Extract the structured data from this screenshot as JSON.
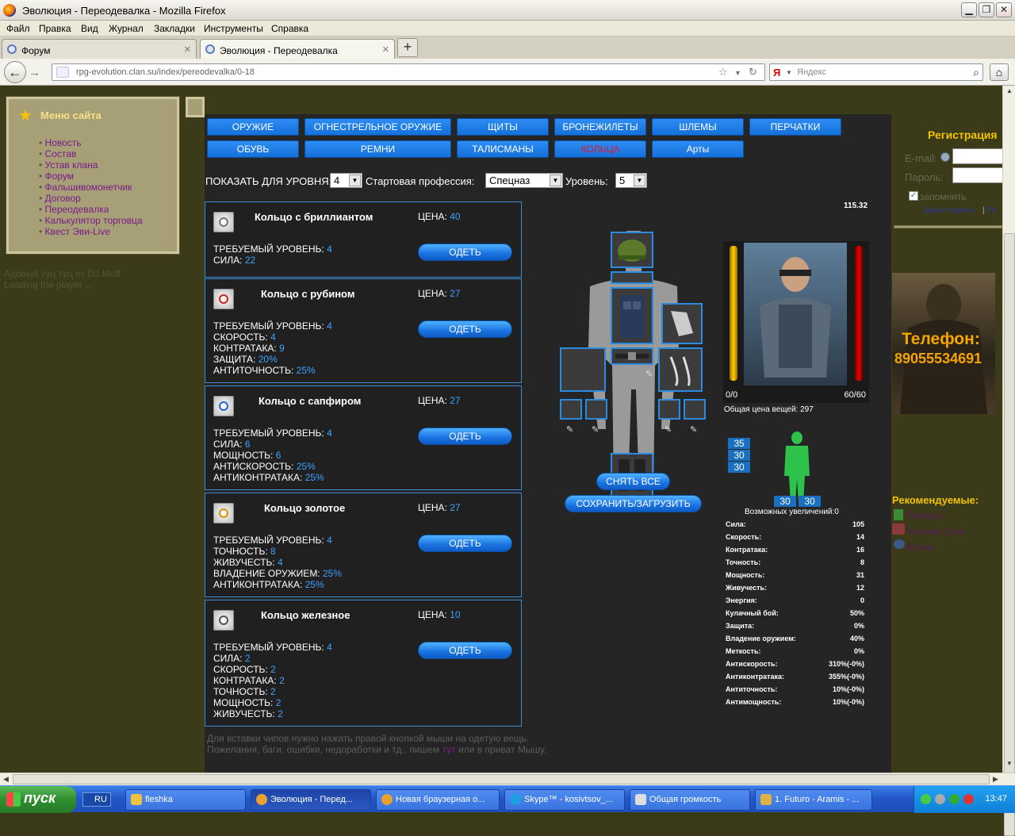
{
  "window": {
    "title": "Эволюция - Переодевалка - Mozilla Firefox"
  },
  "menu": [
    "Файл",
    "Правка",
    "Вид",
    "Журнал",
    "Закладки",
    "Инструменты",
    "Справка"
  ],
  "tabs": [
    {
      "label": "Форум",
      "active": false
    },
    {
      "label": "Эволюция - Переодевалка",
      "active": true
    }
  ],
  "nav": {
    "url": "rpg-evolution.clan.su/index/pereodevalka/0-18",
    "search_engine": "Я",
    "search_placeholder": "Яндекс"
  },
  "sidebar": {
    "title": "Меню сайта",
    "items": [
      "Новость",
      "Состав",
      "Устав клана",
      "Форум",
      "Фальшивомонетчик",
      "Договор",
      "Переодевалка",
      "Калькулятор торговца",
      "Квест Эви-Live"
    ],
    "player_line1": "Адовый туц туц от DJ Moff",
    "player_line2": "Loading the player ..."
  },
  "categories": [
    {
      "label": "ОРУЖИЕ",
      "active": false
    },
    {
      "label": "ОГНЕСТРЕЛЬНОЕ ОРУЖИЕ",
      "active": false
    },
    {
      "label": "ЩИТЫ",
      "active": false
    },
    {
      "label": "БРОНЕЖИЛЕТЫ",
      "active": false
    },
    {
      "label": "ШЛЕМЫ",
      "active": false
    },
    {
      "label": "ПЕРЧАТКИ",
      "active": false
    },
    {
      "label": "ОБУВЬ",
      "active": false
    },
    {
      "label": "РЕМНИ",
      "active": false
    },
    {
      "label": "ТАЛИСМАНЫ",
      "active": false
    },
    {
      "label": "КОЛЬЦА",
      "active": true
    },
    {
      "label": "Арты",
      "active": false
    }
  ],
  "filters": {
    "level_label": "ПОКАЗАТЬ ДЛЯ УРОВНЯ:",
    "level_value": "4",
    "prof_label": "Стартовая профессия:",
    "prof_value": "Спецназ",
    "lvl_label": "Уровень:",
    "lvl_value": "5"
  },
  "item_labels": {
    "price": "ЦЕНА:",
    "equip": "ОДЕТЬ"
  },
  "items": [
    {
      "name": "Кольцо с бриллиантом",
      "price": "40",
      "stats": [
        {
          "label": "ТРЕБУЕМЫЙ УРОВЕНЬ:",
          "value": "4"
        },
        {
          "label": "СИЛА:",
          "value": "22"
        }
      ]
    },
    {
      "name": "Кольцо с рубином",
      "price": "27",
      "stats": [
        {
          "label": "ТРЕБУЕМЫЙ УРОВЕНЬ:",
          "value": "4"
        },
        {
          "label": "СКОРОСТЬ:",
          "value": "4"
        },
        {
          "label": "КОНТРАТАКА:",
          "value": "9"
        },
        {
          "label": "ЗАЩИТА:",
          "value": "20%"
        },
        {
          "label": "АНТИТОЧНОСТЬ:",
          "value": "25%"
        }
      ]
    },
    {
      "name": "Кольцо с сапфиром",
      "price": "27",
      "stats": [
        {
          "label": "ТРЕБУЕМЫЙ УРОВЕНЬ:",
          "value": "4"
        },
        {
          "label": "СИЛА:",
          "value": "6"
        },
        {
          "label": "МОЩНОСТЬ:",
          "value": "6"
        },
        {
          "label": "АНТИСКОРОСТЬ:",
          "value": "25%"
        },
        {
          "label": "АНТИКОНТРАТАКА:",
          "value": "25%"
        }
      ]
    },
    {
      "name": "Кольцо золотое",
      "price": "27",
      "stats": [
        {
          "label": "ТРЕБУЕМЫЙ УРОВЕНЬ:",
          "value": "4"
        },
        {
          "label": "ТОЧНОСТЬ:",
          "value": "8"
        },
        {
          "label": "ЖИВУЧЕСТЬ:",
          "value": "4"
        },
        {
          "label": "ВЛАДЕНИЕ ОРУЖИЕМ:",
          "value": "25%"
        },
        {
          "label": "АНТИКОНТРАТАКА:",
          "value": "25%"
        }
      ]
    },
    {
      "name": "Кольцо железное",
      "price": "10",
      "stats": [
        {
          "label": "ТРЕБУЕМЫЙ УРОВЕНЬ:",
          "value": "4"
        },
        {
          "label": "СИЛА:",
          "value": "2"
        },
        {
          "label": "СКОРОСТЬ:",
          "value": "2"
        },
        {
          "label": "КОНТРАТАКА:",
          "value": "2"
        },
        {
          "label": "ТОЧНОСТЬ:",
          "value": "2"
        },
        {
          "label": "МОЩНОСТЬ:",
          "value": "2"
        },
        {
          "label": "ЖИВУЧЕСТЬ:",
          "value": "2"
        }
      ]
    }
  ],
  "doll": {
    "remove_all": "СНЯТЬ ВСЕ",
    "save_load": "СОХРАНИТЬ/ЗАГРУЗИТЬ"
  },
  "character": {
    "weight": "115.32",
    "left_value": "0/0",
    "right_value": "60/60",
    "total_price": "Общая цена вещей: 297",
    "side_nums": [
      "35",
      "30",
      "30"
    ],
    "bottom_nums": [
      "30",
      "30"
    ],
    "increases": "Возможных увеличений:0",
    "stats": [
      {
        "label": "Сила:",
        "value": "105"
      },
      {
        "label": "Скорость:",
        "value": "14"
      },
      {
        "label": "Контратака:",
        "value": "16"
      },
      {
        "label": "Точность:",
        "value": "8"
      },
      {
        "label": "Мощность:",
        "value": "31"
      },
      {
        "label": "Живучесть:",
        "value": "12"
      },
      {
        "label": "Энергия:",
        "value": "0"
      },
      {
        "label": "Кулачный бой:",
        "value": "50%"
      },
      {
        "label": "Защита:",
        "value": "0%"
      },
      {
        "label": "Владение оружием:",
        "value": "40%"
      },
      {
        "label": "Меткость:",
        "value": "0%"
      },
      {
        "label": "Антискорость:",
        "value": "310%(-0%)"
      },
      {
        "label": "Антиконтратака:",
        "value": "355%(-0%)"
      },
      {
        "label": "Антиточность:",
        "value": "10%(-0%)"
      },
      {
        "label": "Антимощность:",
        "value": "10%(-0%)"
      }
    ]
  },
  "footer": {
    "line1": "Для вставки чипов нужно нажать правой кнопкой мыши на одетую вещь.",
    "line2_a": "Пожелания, баги, ошибки, недоработки и тд., пишем",
    "line2_link": "тут",
    "line2_b": "или в приват Мышу."
  },
  "registration": {
    "title": "Регистрация",
    "email_label": "E-mail:",
    "password_label": "Пароль:",
    "remember": "запомнить",
    "forgot": "Забыл пароль",
    "separator": "|",
    "register_fragment": "Ре"
  },
  "phone": {
    "title": "Телефон:",
    "number": "89055534691"
  },
  "recommended": {
    "title": "Рекомендуемые:",
    "items": [
      "Принцес",
      "Ночные Стаи",
      "Итачи"
    ]
  },
  "taskbar": {
    "start": "пуск",
    "lang": "RU",
    "tasks": [
      {
        "label": "fleshka",
        "active": false
      },
      {
        "label": "Эволюция - Перед...",
        "active": true
      },
      {
        "label": "Новая браузерная о...",
        "active": false
      },
      {
        "label": "Skype™ - kosivtsov_...",
        "active": false
      },
      {
        "label": "Общая громкость",
        "active": false
      },
      {
        "label": "1. Futuro - Aramis - ...",
        "active": false
      }
    ],
    "clock": "13:47"
  }
}
